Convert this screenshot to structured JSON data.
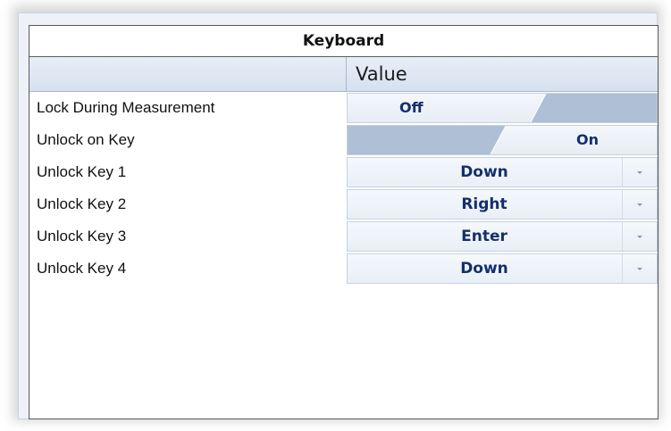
{
  "panel": {
    "title": "Keyboard",
    "value_header": "Value"
  },
  "rows": [
    {
      "label": "Lock During Measurement",
      "type": "toggle",
      "value": "Off"
    },
    {
      "label": "Unlock on Key",
      "type": "toggle",
      "value": "On"
    },
    {
      "label": "Unlock Key 1",
      "type": "dropdown",
      "value": "Down"
    },
    {
      "label": "Unlock Key 2",
      "type": "dropdown",
      "value": "Right"
    },
    {
      "label": "Unlock Key 3",
      "type": "dropdown",
      "value": "Enter"
    },
    {
      "label": "Unlock Key 4",
      "type": "dropdown",
      "value": "Down"
    }
  ],
  "icons": {
    "dropdown_arrow": "chevron-down-icon"
  },
  "colors": {
    "value_text": "#14306b",
    "toggle_fill": "#aebfd6",
    "header_bg": "#dbe4f1"
  }
}
